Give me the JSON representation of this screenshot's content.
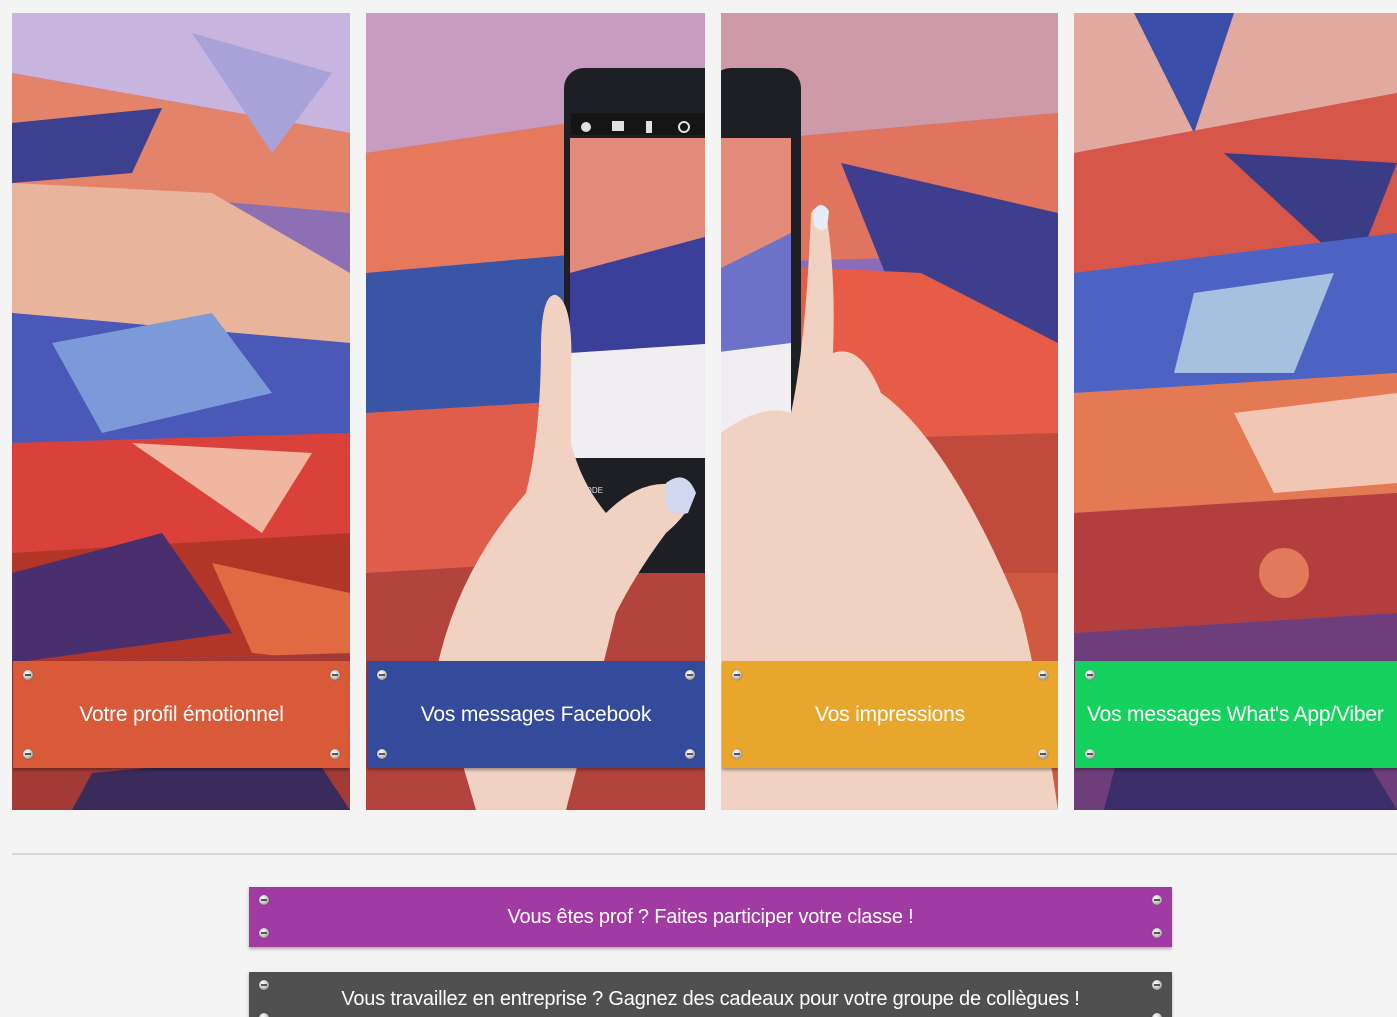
{
  "panels": [
    {
      "label": "Votre profil émotionnel",
      "color": "#d95a39"
    },
    {
      "label": "Vos messages Facebook",
      "color": "#344a9a"
    },
    {
      "label": "Vos impressions",
      "color": "#e8a62c"
    },
    {
      "label": "Vos messages What's App/Viber",
      "color": "#15d25e"
    }
  ],
  "banners": {
    "prof": {
      "label": "Vous êtes prof ? Faites participer votre classe !",
      "color": "#a23aa3"
    },
    "work": {
      "label": "Vous travaillez en entreprise ? Gagnez des cadeaux pour votre groupe de collègues !",
      "color": "#505050"
    }
  },
  "phone_ui": {
    "mode_label": "MODE"
  }
}
